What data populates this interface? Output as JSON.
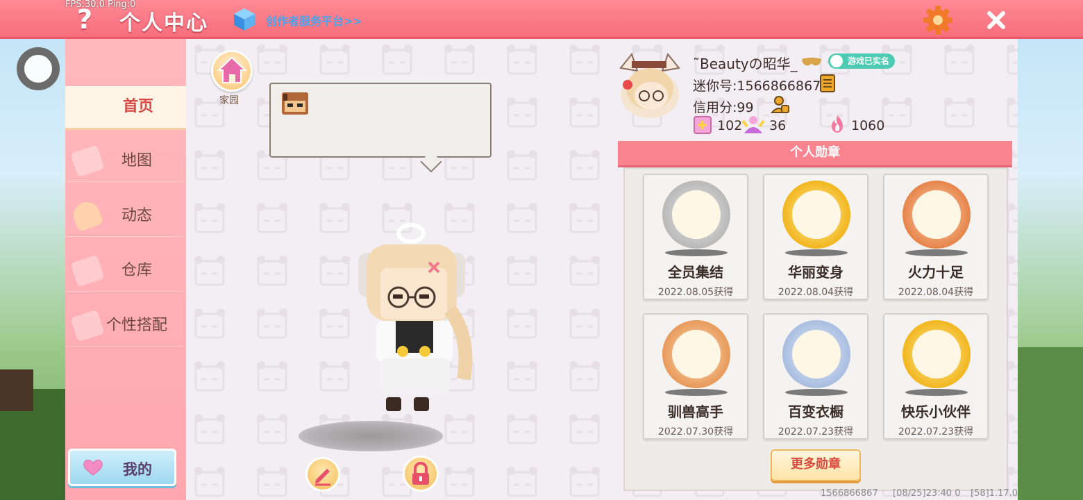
{
  "debug": {
    "fps": "FPS:30.0",
    "ping": "Ping:0"
  },
  "topbar": {
    "title": "个人中心",
    "creator_link": "创作者服务平台>>"
  },
  "sidebar": {
    "items": [
      {
        "label": "首页",
        "active": true
      },
      {
        "label": "地图",
        "active": false
      },
      {
        "label": "动态",
        "active": false
      },
      {
        "label": "仓库",
        "active": false
      },
      {
        "label": "个性搭配",
        "active": false
      }
    ],
    "mine_label": "我的"
  },
  "main": {
    "home_label": "家园"
  },
  "profile": {
    "nickname": "˜Beautyの昭华_",
    "verified_label": "游戏已实名",
    "mini_id": "迷你号:1566866867",
    "credit": "信用分:99",
    "stats": {
      "flowers": "102",
      "fans": "36",
      "popularity": "1060"
    }
  },
  "medals": {
    "header": "个人勋章",
    "items": [
      {
        "name": "全员集结",
        "date": "2022.08.05获得",
        "color": "#b9b9b9"
      },
      {
        "name": "华丽变身",
        "date": "2022.08.04获得",
        "color": "#f2b61f"
      },
      {
        "name": "火力十足",
        "date": "2022.08.04获得",
        "color": "#e6844a"
      },
      {
        "name": "驯兽高手",
        "date": "2022.07.30获得",
        "color": "#e89a5a"
      },
      {
        "name": "百变衣橱",
        "date": "2022.07.23获得",
        "color": "#a9bde0"
      },
      {
        "name": "快乐小伙伴",
        "date": "2022.07.23获得",
        "color": "#f2b61f"
      }
    ],
    "more_label": "更多勋章"
  },
  "footer": {
    "id": "1566866867",
    "time": "[08/25]23:40 0",
    "version": "[58]1.17.0"
  },
  "colors": {
    "accent": "#f76e7c",
    "sidebar": "#ffb0b6",
    "active_nav_text": "#d54a45"
  }
}
